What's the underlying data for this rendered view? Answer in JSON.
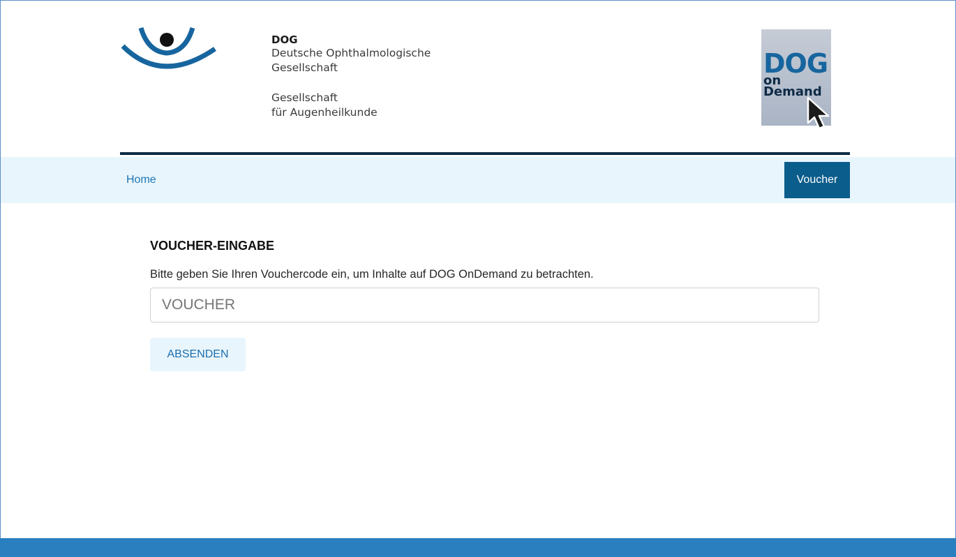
{
  "header": {
    "org_name": "DOG",
    "org_full_line1": "Deutsche Ophthalmologische",
    "org_full_line2": "Gesellschaft",
    "tagline_line1": "Gesellschaft",
    "tagline_line2": "für Augenheilkunde",
    "badge": {
      "big": "DOG",
      "line2": "on",
      "line3": "Demand"
    }
  },
  "nav": {
    "home_label": "Home",
    "voucher_label": "Voucher"
  },
  "voucher_form": {
    "title": "VOUCHER-EINGABE",
    "description": "Bitte geben Sie Ihren Vouchercode ein, um Inhalte auf DOG OnDemand zu betrachten.",
    "input_value": "",
    "input_placeholder": "VOUCHER",
    "submit_label": "ABSENDEN"
  },
  "colors": {
    "brand_blue": "#1e74b4",
    "dark_navy": "#0e2c44",
    "nav_bg": "#e8f5fd",
    "active_tab": "#0b5d8b",
    "footer": "#2a7fbf"
  },
  "icons": [
    "eye-logo-icon",
    "mouse-cursor-icon"
  ]
}
